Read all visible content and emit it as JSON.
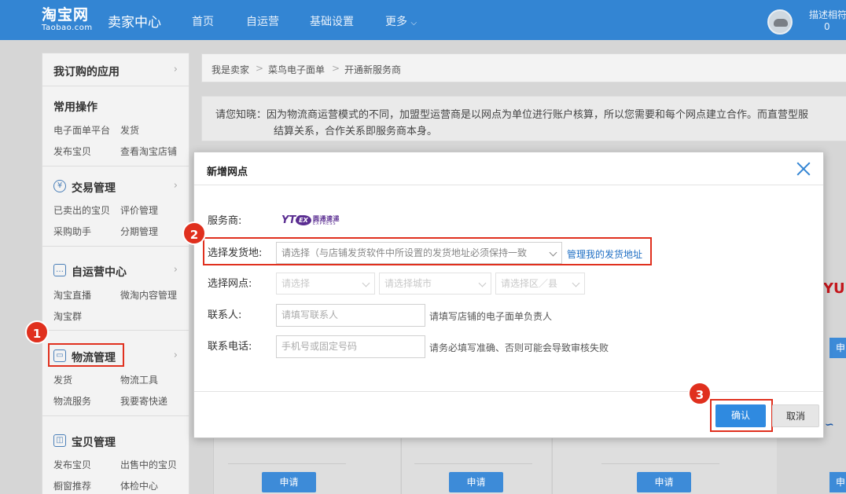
{
  "header": {
    "logo_cn": "淘宝网",
    "logo_en": "Taobao.com",
    "title": "卖家中心",
    "nav": [
      "首页",
      "自运营",
      "基础设置",
      "更多"
    ],
    "desc_label": "描述相符",
    "desc_value": "0"
  },
  "sidebar": {
    "my_apps": "我订购的应用",
    "common": "常用操作",
    "common_links": [
      "电子面单平台",
      "发货",
      "发布宝贝",
      "查看淘宝店铺"
    ],
    "trade": "交易管理",
    "trade_links": [
      "已卖出的宝贝",
      "评价管理",
      "采购助手",
      "分期管理"
    ],
    "selfop": "自运营中心",
    "selfop_links": [
      "淘宝直播",
      "微淘内容管理",
      "淘宝群"
    ],
    "logistics": "物流管理",
    "logistics_links": [
      "发货",
      "物流工具",
      "物流服务",
      "我要寄快递"
    ],
    "goods": "宝贝管理",
    "goods_links": [
      "发布宝贝",
      "出售中的宝贝",
      "橱窗推荐",
      "体检中心"
    ]
  },
  "breadcrumb": [
    "我是卖家",
    "菜鸟电子面单",
    "开通新服务商"
  ],
  "notice": {
    "line1": "请您知晓：因为物流商运营模式的不同，加盟型运营商是以网点为单位进行账户核算，所以您需要和每个网点建立合作。而直营型服",
    "line2": "结算关系，合作关系即服务商本身。"
  },
  "background": {
    "apply_label": "申请",
    "partial_logo": "YU",
    "partial_btn": "申"
  },
  "modal": {
    "title": "新增网点",
    "provider_label": "服务商:",
    "provider_logo": {
      "mark": "YTO",
      "ring": "EX",
      "cn": "圆通速递",
      "en": "EXPRESS"
    },
    "ship_from_label": "选择发货地:",
    "ship_from_placeholder": "请选择（与店铺发货软件中所设置的发货地址必须保持一致",
    "manage_address_link": "管理我的发货地址",
    "outlet_label": "选择网点:",
    "outlet_selects": [
      "请选择",
      "请选择城市",
      "请选择区／县"
    ],
    "contact_label": "联系人:",
    "contact_placeholder": "请填写联系人",
    "contact_hint": "请填写店铺的电子面单负责人",
    "phone_label": "联系电话:",
    "phone_placeholder": "手机号或固定号码",
    "phone_hint": "请务必填写准确、否则可能会导致审核失败",
    "confirm_label": "确认",
    "cancel_label": "取消"
  },
  "annotations": [
    "1",
    "2",
    "3"
  ],
  "colors": {
    "topbar": "#3385d3",
    "highlight": "#e0301e",
    "primary": "#2f8ae0"
  }
}
